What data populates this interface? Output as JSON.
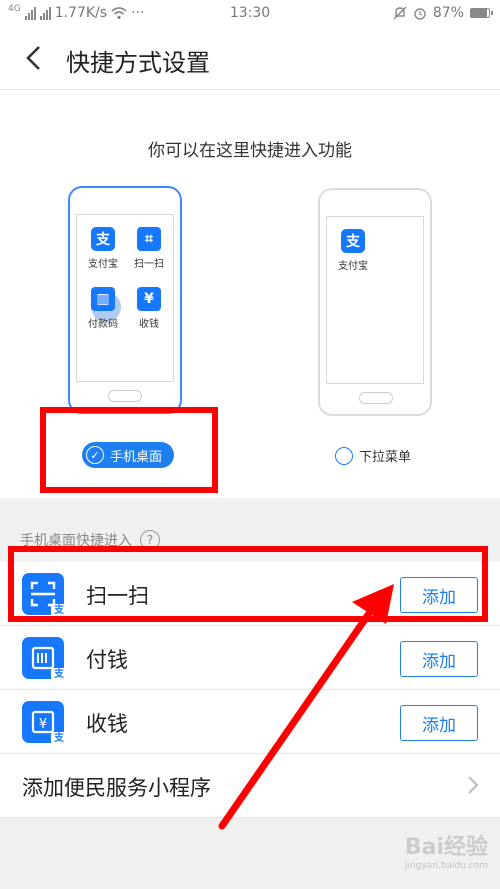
{
  "status": {
    "net": "4G",
    "speed": "1.77K/s",
    "more": "···",
    "time": "13:30",
    "battery": "87%",
    "battery_level": 0.87
  },
  "header": {
    "title": "快捷方式设置"
  },
  "intro": {
    "text": "你可以在这里快捷进入功能"
  },
  "desktop_preview": {
    "icons": [
      {
        "glyph": "支",
        "label": "支付宝"
      },
      {
        "glyph": "⌗",
        "label": "扫一扫"
      },
      {
        "glyph": "▥",
        "label": "付款码"
      },
      {
        "glyph": "¥",
        "label": "收钱"
      }
    ]
  },
  "dropdown_preview": {
    "icons": [
      {
        "glyph": "支",
        "label": "支付宝"
      }
    ]
  },
  "options": {
    "desktop": {
      "label": "手机桌面",
      "selected": true
    },
    "dropdown": {
      "label": "下拉菜单",
      "selected": false
    }
  },
  "section": {
    "label": "手机桌面快捷进入",
    "help": "?"
  },
  "items": [
    {
      "label": "扫一扫",
      "button": "添加",
      "icon": "scan-icon"
    },
    {
      "label": "付钱",
      "button": "添加",
      "icon": "pay-icon"
    },
    {
      "label": "收钱",
      "button": "添加",
      "icon": "receive-icon"
    }
  ],
  "more": {
    "label": "添加便民服务小程序"
  },
  "watermark": {
    "text": "Bai经验",
    "sub": "jingyan.baidu.com"
  },
  "colors": {
    "accent": "#1e7ff0",
    "annotation": "#ff0000",
    "icon_bg": "#1677ff"
  }
}
